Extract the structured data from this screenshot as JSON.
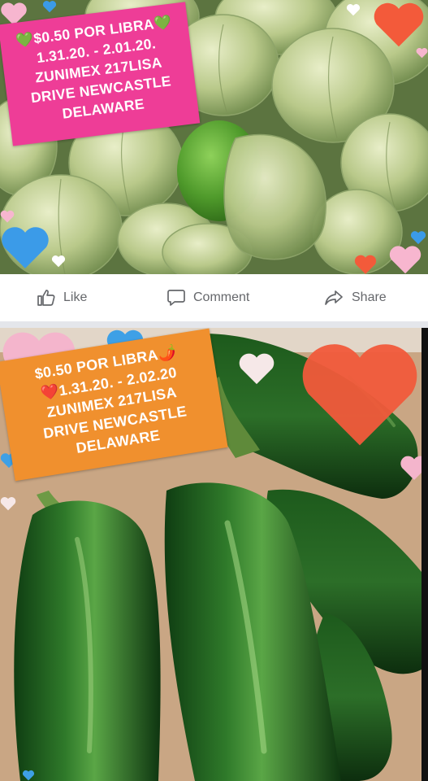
{
  "posts": [
    {
      "image_subject": "tomatillos",
      "sticker": {
        "lines": [
          "💚$0.50 POR LIBRA💚",
          "1.31.20. - 2.01.20.",
          "ZUNIMEX 217LISA",
          "DRIVE NEWCASTLE",
          "DELAWARE"
        ]
      }
    },
    {
      "image_subject": "jalapeno peppers",
      "sticker": {
        "lines": [
          "$0.50 POR LIBRA🌶️",
          "❤️1.31.20. - 2.02.20",
          "ZUNIMEX 217LISA",
          "DRIVE NEWCASTLE",
          "DELAWARE"
        ]
      }
    }
  ],
  "actions": {
    "like": "Like",
    "comment": "Comment",
    "share": "Share"
  },
  "colors": {
    "pink_sticker": "#ee3d97",
    "orange_sticker": "#f0902e",
    "action_text": "#65676b",
    "divider": "#e4e6eb"
  },
  "icons": [
    "like-icon",
    "comment-icon",
    "share-icon",
    "heart-icon"
  ]
}
